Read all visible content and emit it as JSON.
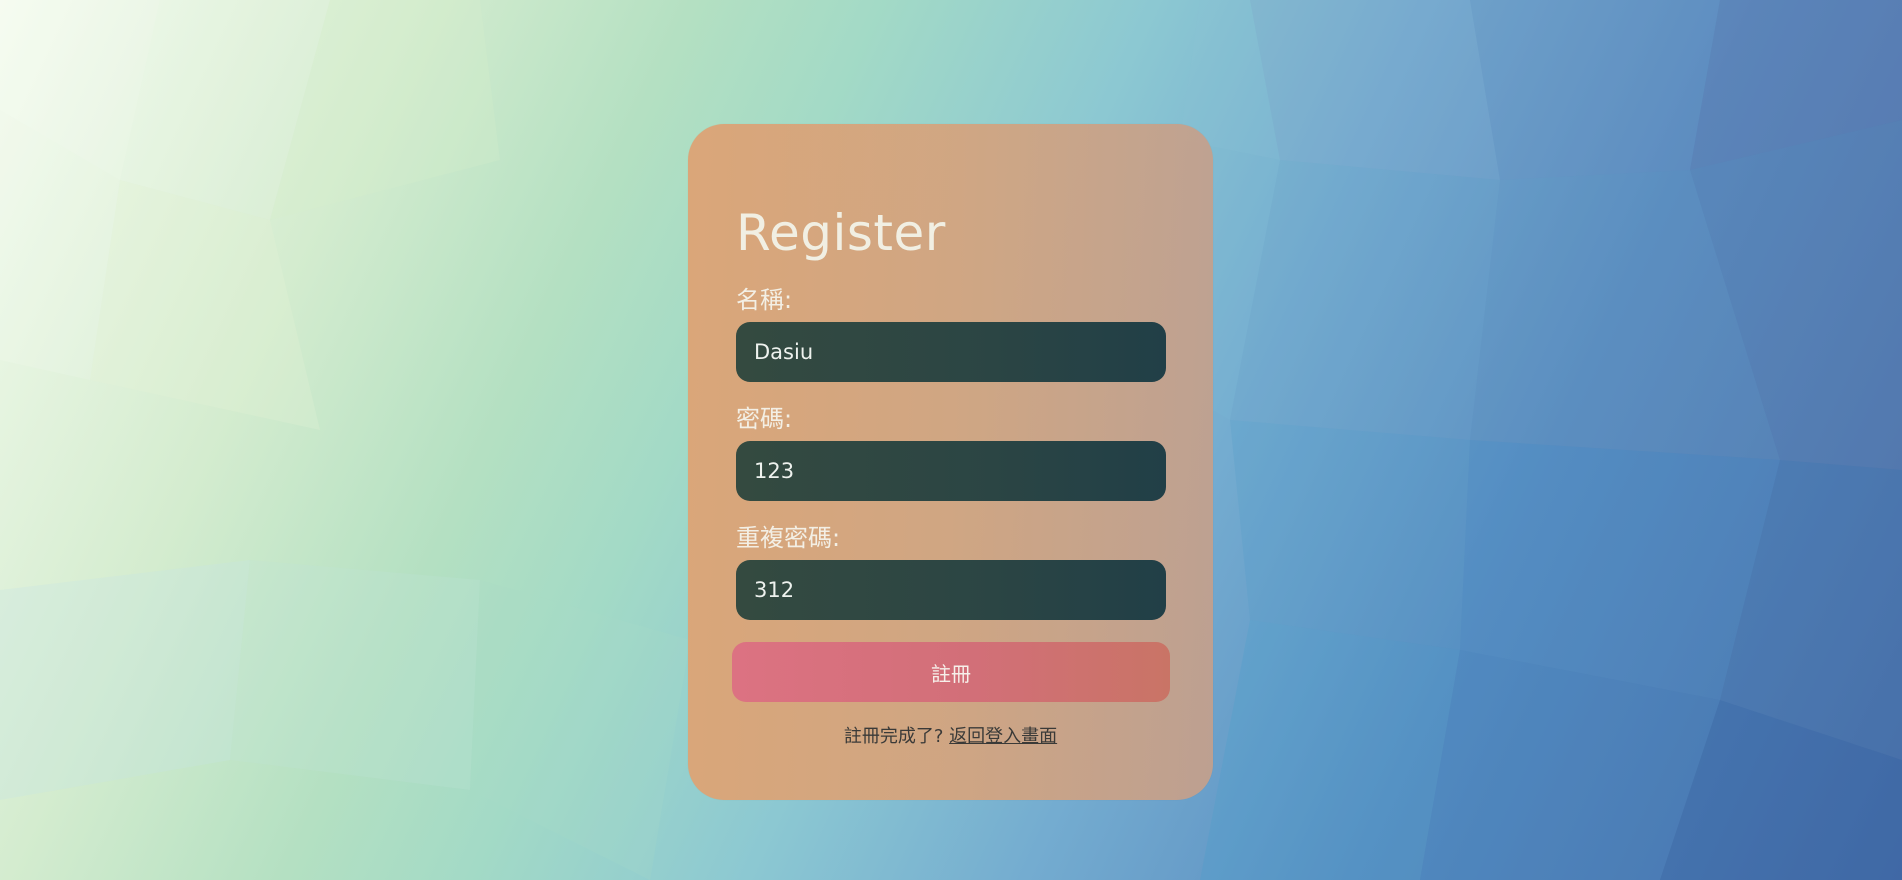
{
  "form": {
    "title": "Register",
    "name_label": "名稱:",
    "name_value": "Dasiu",
    "password_label": "密碼:",
    "password_value": "123",
    "repeat_password_label": "重複密碼:",
    "repeat_password_value": "312",
    "submit_label": "註冊",
    "footer_text": "註冊完成了?",
    "footer_link": "返回登入畫面"
  },
  "colors": {
    "card": "#d9a67c",
    "input_bg": "#2b4544",
    "button": "#d87178",
    "title_text": "#f1efe3"
  }
}
